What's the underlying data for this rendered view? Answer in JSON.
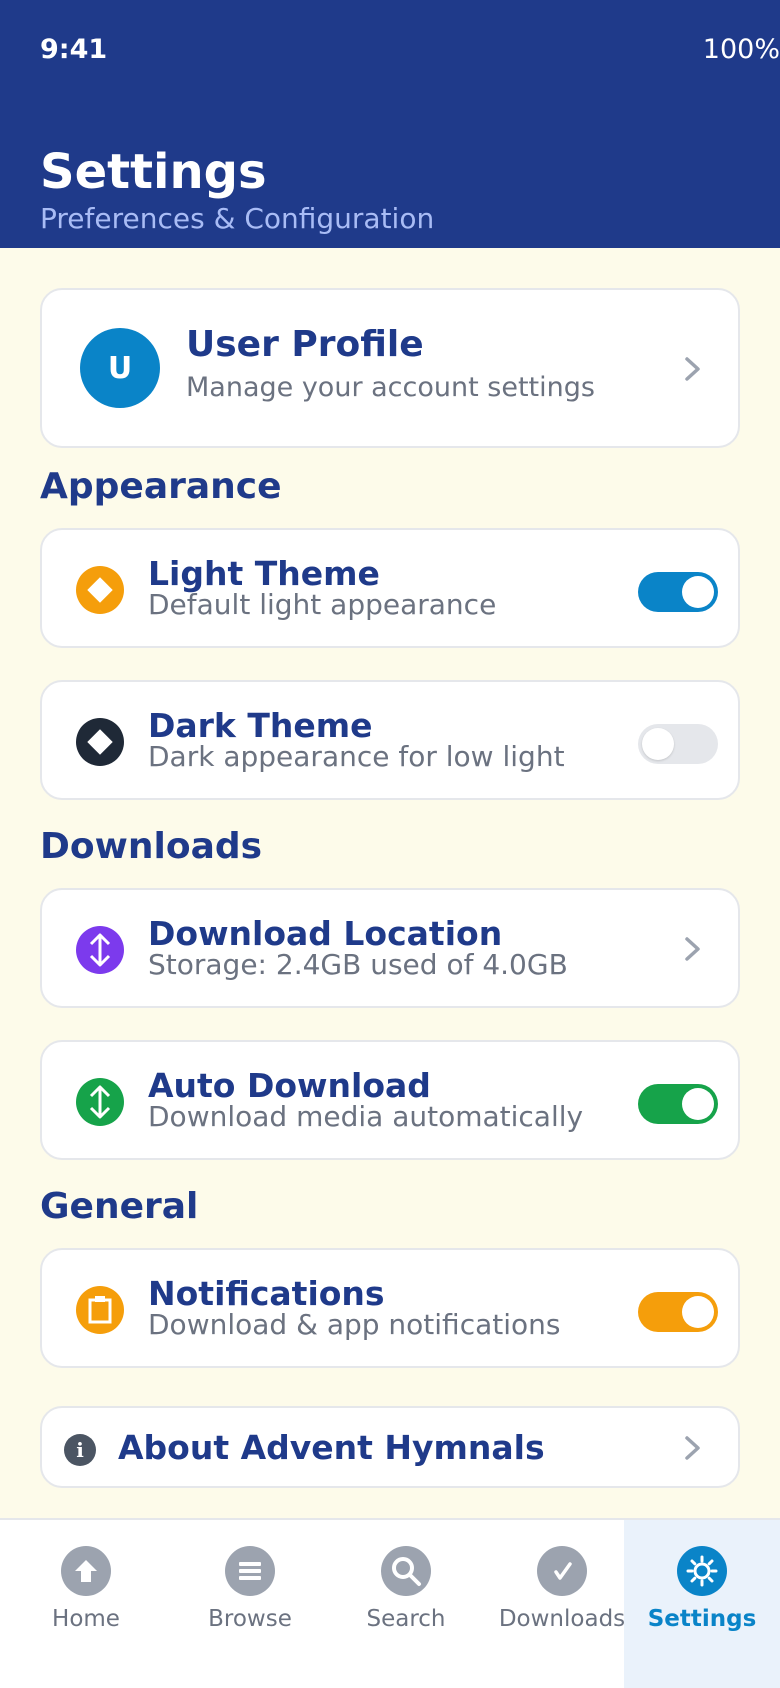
{
  "status_bar": {
    "time": "9:41",
    "battery": "100%"
  },
  "header": {
    "title": "Settings",
    "subtitle": "Preferences & Configuration"
  },
  "profile": {
    "avatar_letter": "U",
    "name": "User Profile",
    "description": "Manage your account settings",
    "icon": "chevron-right-icon"
  },
  "sections": {
    "appearance": {
      "title": "Appearance",
      "light_theme": {
        "title": "Light Theme",
        "description": "Default light appearance",
        "enabled": true,
        "icon": "diamond-icon",
        "color": "#f59e0b",
        "toggle_color": "#0a84c8"
      },
      "dark_theme": {
        "title": "Dark Theme",
        "description": "Dark appearance for low light",
        "enabled": false,
        "icon": "diamond-icon",
        "color": "#1f2937"
      }
    },
    "downloads": {
      "title": "Downloads",
      "location": {
        "title": "Download Location",
        "description": "Storage: 2.4GB used of 4.0GB",
        "icon": "arrows-vertical-icon",
        "color": "#7c3aed"
      },
      "auto_download": {
        "title": "Auto Download",
        "description": "Download media automatically",
        "enabled": true,
        "icon": "arrows-vertical-icon",
        "color": "#16a34a",
        "toggle_color": "#16a34a"
      }
    },
    "general": {
      "title": "General",
      "notifications": {
        "title": "Notifications",
        "description": "Download & app notifications",
        "enabled": true,
        "icon": "clipboard-icon",
        "color": "#f59e0b",
        "toggle_color": "#f59e0b"
      }
    }
  },
  "about": {
    "label": "About Advent Hymnals",
    "icon": "info-icon"
  },
  "tabs": [
    {
      "label": "Home",
      "icon": "home-icon",
      "active": false
    },
    {
      "label": "Browse",
      "icon": "list-icon",
      "active": false
    },
    {
      "label": "Search",
      "icon": "search-icon",
      "active": false
    },
    {
      "label": "Downloads",
      "icon": "download-icon",
      "active": false
    },
    {
      "label": "Settings",
      "icon": "gear-icon",
      "active": true
    }
  ],
  "colors": {
    "primary": "#1f3a8a",
    "accent": "#0a84c8",
    "background": "#fdfbea"
  }
}
